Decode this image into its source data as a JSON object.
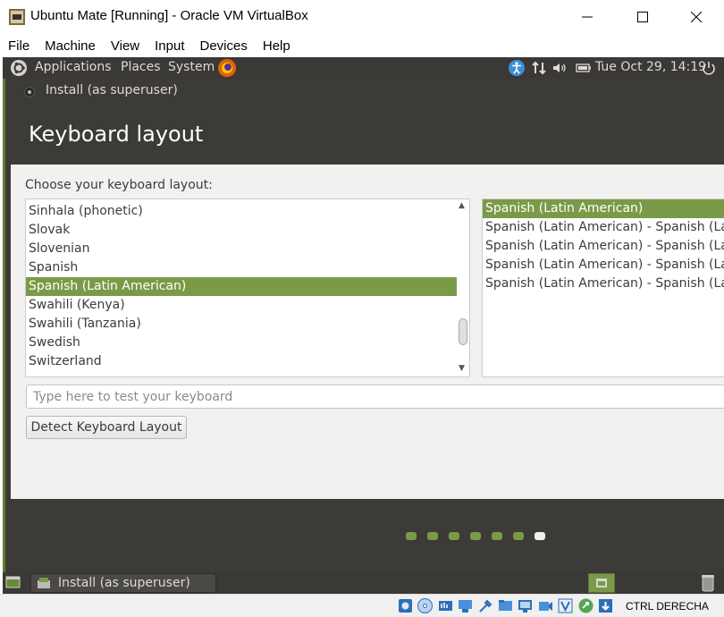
{
  "window": {
    "title": "Ubuntu Mate [Running] - Oracle VM VirtualBox"
  },
  "vbox_menu": [
    "File",
    "Machine",
    "View",
    "Input",
    "Devices",
    "Help"
  ],
  "top_panel": {
    "menus": [
      "Applications",
      "Places",
      "System"
    ],
    "clock": "Tue Oct 29, 14:19"
  },
  "installer": {
    "window_title": "Install (as superuser)",
    "heading": "Keyboard layout",
    "choose_label": "Choose your keyboard layout:",
    "layouts": [
      "Sinhala (phonetic)",
      "Slovak",
      "Slovenian",
      "Spanish",
      "Spanish (Latin American)",
      "Swahili (Kenya)",
      "Swahili (Tanzania)",
      "Swedish",
      "Switzerland"
    ],
    "selected_layout": "Spanish (Latin American)",
    "variants": [
      "Spanish (Latin American)",
      "Spanish (Latin American) - Spanish (Lat",
      "Spanish (Latin American) - Spanish (Lat",
      "Spanish (Latin American) - Spanish (Lat",
      "Spanish (Latin American) - Spanish (Lat"
    ],
    "selected_variant": "Spanish (Latin American)",
    "test_placeholder": "Type here to test your keyboard",
    "detect_button": "Detect Keyboard Layout",
    "progress": {
      "total": 7,
      "current": 7
    }
  },
  "bottom_panel": {
    "task": "Install (as superuser)"
  },
  "vbox_status": {
    "host_key": "CTRL DERECHA"
  },
  "colors": {
    "accent": "#7a9a48",
    "panel": "#3a3935",
    "content_bg": "#f2f1f0"
  }
}
